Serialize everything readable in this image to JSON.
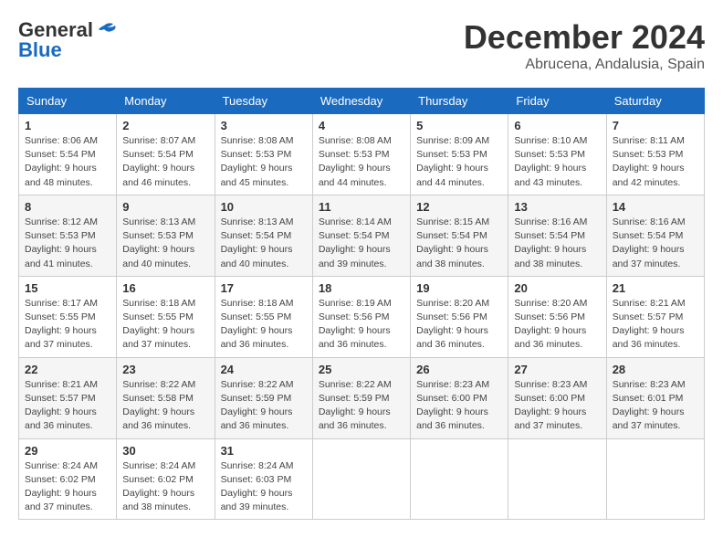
{
  "logo": {
    "line1": "General",
    "line2": "Blue"
  },
  "header": {
    "month": "December 2024",
    "location": "Abrucena, Andalusia, Spain"
  },
  "weekdays": [
    "Sunday",
    "Monday",
    "Tuesday",
    "Wednesday",
    "Thursday",
    "Friday",
    "Saturday"
  ],
  "weeks": [
    [
      {
        "day": "1",
        "sunrise": "8:06 AM",
        "sunset": "5:54 PM",
        "daylight": "9 hours and 48 minutes."
      },
      {
        "day": "2",
        "sunrise": "8:07 AM",
        "sunset": "5:54 PM",
        "daylight": "9 hours and 46 minutes."
      },
      {
        "day": "3",
        "sunrise": "8:08 AM",
        "sunset": "5:53 PM",
        "daylight": "9 hours and 45 minutes."
      },
      {
        "day": "4",
        "sunrise": "8:08 AM",
        "sunset": "5:53 PM",
        "daylight": "9 hours and 44 minutes."
      },
      {
        "day": "5",
        "sunrise": "8:09 AM",
        "sunset": "5:53 PM",
        "daylight": "9 hours and 44 minutes."
      },
      {
        "day": "6",
        "sunrise": "8:10 AM",
        "sunset": "5:53 PM",
        "daylight": "9 hours and 43 minutes."
      },
      {
        "day": "7",
        "sunrise": "8:11 AM",
        "sunset": "5:53 PM",
        "daylight": "9 hours and 42 minutes."
      }
    ],
    [
      {
        "day": "8",
        "sunrise": "8:12 AM",
        "sunset": "5:53 PM",
        "daylight": "9 hours and 41 minutes."
      },
      {
        "day": "9",
        "sunrise": "8:13 AM",
        "sunset": "5:53 PM",
        "daylight": "9 hours and 40 minutes."
      },
      {
        "day": "10",
        "sunrise": "8:13 AM",
        "sunset": "5:54 PM",
        "daylight": "9 hours and 40 minutes."
      },
      {
        "day": "11",
        "sunrise": "8:14 AM",
        "sunset": "5:54 PM",
        "daylight": "9 hours and 39 minutes."
      },
      {
        "day": "12",
        "sunrise": "8:15 AM",
        "sunset": "5:54 PM",
        "daylight": "9 hours and 38 minutes."
      },
      {
        "day": "13",
        "sunrise": "8:16 AM",
        "sunset": "5:54 PM",
        "daylight": "9 hours and 38 minutes."
      },
      {
        "day": "14",
        "sunrise": "8:16 AM",
        "sunset": "5:54 PM",
        "daylight": "9 hours and 37 minutes."
      }
    ],
    [
      {
        "day": "15",
        "sunrise": "8:17 AM",
        "sunset": "5:55 PM",
        "daylight": "9 hours and 37 minutes."
      },
      {
        "day": "16",
        "sunrise": "8:18 AM",
        "sunset": "5:55 PM",
        "daylight": "9 hours and 37 minutes."
      },
      {
        "day": "17",
        "sunrise": "8:18 AM",
        "sunset": "5:55 PM",
        "daylight": "9 hours and 36 minutes."
      },
      {
        "day": "18",
        "sunrise": "8:19 AM",
        "sunset": "5:56 PM",
        "daylight": "9 hours and 36 minutes."
      },
      {
        "day": "19",
        "sunrise": "8:20 AM",
        "sunset": "5:56 PM",
        "daylight": "9 hours and 36 minutes."
      },
      {
        "day": "20",
        "sunrise": "8:20 AM",
        "sunset": "5:56 PM",
        "daylight": "9 hours and 36 minutes."
      },
      {
        "day": "21",
        "sunrise": "8:21 AM",
        "sunset": "5:57 PM",
        "daylight": "9 hours and 36 minutes."
      }
    ],
    [
      {
        "day": "22",
        "sunrise": "8:21 AM",
        "sunset": "5:57 PM",
        "daylight": "9 hours and 36 minutes."
      },
      {
        "day": "23",
        "sunrise": "8:22 AM",
        "sunset": "5:58 PM",
        "daylight": "9 hours and 36 minutes."
      },
      {
        "day": "24",
        "sunrise": "8:22 AM",
        "sunset": "5:59 PM",
        "daylight": "9 hours and 36 minutes."
      },
      {
        "day": "25",
        "sunrise": "8:22 AM",
        "sunset": "5:59 PM",
        "daylight": "9 hours and 36 minutes."
      },
      {
        "day": "26",
        "sunrise": "8:23 AM",
        "sunset": "6:00 PM",
        "daylight": "9 hours and 36 minutes."
      },
      {
        "day": "27",
        "sunrise": "8:23 AM",
        "sunset": "6:00 PM",
        "daylight": "9 hours and 37 minutes."
      },
      {
        "day": "28",
        "sunrise": "8:23 AM",
        "sunset": "6:01 PM",
        "daylight": "9 hours and 37 minutes."
      }
    ],
    [
      {
        "day": "29",
        "sunrise": "8:24 AM",
        "sunset": "6:02 PM",
        "daylight": "9 hours and 37 minutes."
      },
      {
        "day": "30",
        "sunrise": "8:24 AM",
        "sunset": "6:02 PM",
        "daylight": "9 hours and 38 minutes."
      },
      {
        "day": "31",
        "sunrise": "8:24 AM",
        "sunset": "6:03 PM",
        "daylight": "9 hours and 39 minutes."
      },
      null,
      null,
      null,
      null
    ]
  ]
}
